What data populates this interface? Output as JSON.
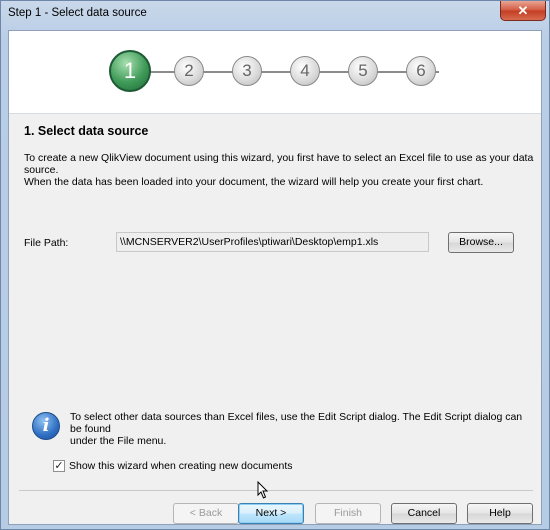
{
  "window": {
    "title": "Step 1 - Select data source",
    "close_glyph": "✕"
  },
  "steps": [
    "1",
    "2",
    "3",
    "4",
    "5",
    "6"
  ],
  "current_step": 1,
  "section": {
    "title": "1. Select data source",
    "description_line1": "To create a new QlikView document using this wizard, you first have to select an Excel file to use as your data source.",
    "description_line2": "When the data has been loaded into your document, the wizard will help you create your first chart."
  },
  "file_path": {
    "label": "File Path:",
    "value": "\\\\MCNSERVER2\\UserProfiles\\ptiwari\\Desktop\\emp1.xls",
    "browse_label": "Browse..."
  },
  "info": {
    "icon": "info-icon",
    "line1": "To select other data sources than Excel files, use the Edit Script dialog. The Edit Script dialog can be found",
    "line2": "under the File menu."
  },
  "show_wizard": {
    "label": "Show this wizard when creating new documents",
    "checked": true,
    "check_glyph": "✓"
  },
  "buttons": {
    "back": "< Back",
    "next": "Next >",
    "finish": "Finish",
    "cancel": "Cancel",
    "help": "Help"
  }
}
